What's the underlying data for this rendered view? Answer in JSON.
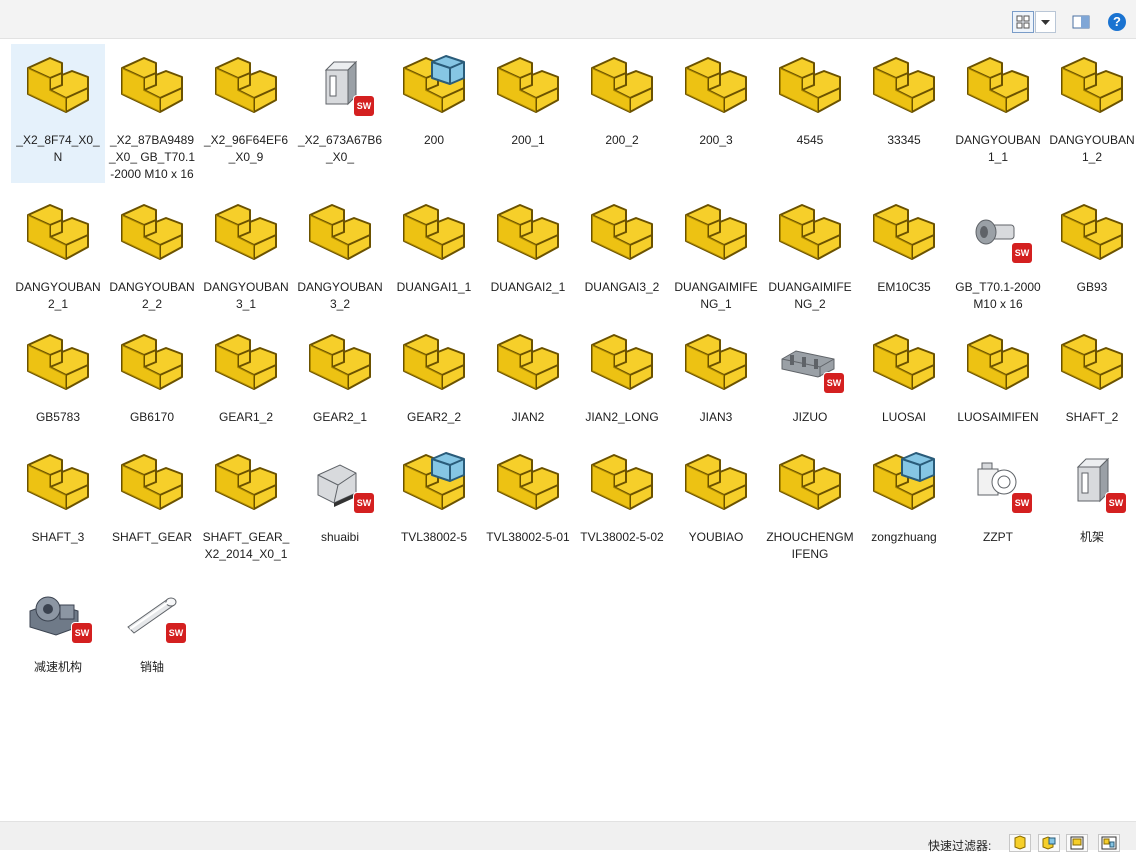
{
  "toolbar": {
    "view_icon": "thumbnail-view-icon",
    "dropdown_icon": "chevron-down-icon",
    "preview_icon": "preview-pane-icon",
    "help_label": "?"
  },
  "colors": {
    "folder_yellow": "#f6cf2a",
    "folder_edge": "#8a6b00",
    "assembly_blue": "#86c6e4",
    "sw_red": "#d42020",
    "selected_bg": "#e5f1fb"
  },
  "items": [
    {
      "label": "_X2_8F74_X0_N",
      "icon": "part-icon",
      "selected": true
    },
    {
      "label": "_X2_87BA9489_X0_ GB_T70.1-2000 M10 x 16",
      "icon": "part-icon"
    },
    {
      "label": "_X2_96F64EF6_X0_9",
      "icon": "part-icon"
    },
    {
      "label": "_X2_673A67B6_X0_",
      "icon": "profile-thumbnail-icon"
    },
    {
      "label": "200",
      "icon": "assembly-icon"
    },
    {
      "label": "200_1",
      "icon": "part-icon"
    },
    {
      "label": "200_2",
      "icon": "part-icon"
    },
    {
      "label": "200_3",
      "icon": "part-icon"
    },
    {
      "label": "4545",
      "icon": "part-icon"
    },
    {
      "label": "33345",
      "icon": "part-icon"
    },
    {
      "label": "DANGYOUBAN1_1",
      "icon": "part-icon"
    },
    {
      "label": "DANGYOUBAN1_2",
      "icon": "part-icon"
    },
    {
      "label": "DANGYOUBAN2_1",
      "icon": "part-icon"
    },
    {
      "label": "DANGYOUBAN2_2",
      "icon": "part-icon"
    },
    {
      "label": "DANGYOUBAN3_1",
      "icon": "part-icon"
    },
    {
      "label": "DANGYOUBAN3_2",
      "icon": "part-icon"
    },
    {
      "label": "DUANGAI1_1",
      "icon": "part-icon"
    },
    {
      "label": "DUANGAI2_1",
      "icon": "part-icon"
    },
    {
      "label": "DUANGAI3_2",
      "icon": "part-icon"
    },
    {
      "label": "DUANGAIMIFENG_1",
      "icon": "part-icon"
    },
    {
      "label": "DUANGAIMIFENG_2",
      "icon": "part-icon"
    },
    {
      "label": "EM10C35",
      "icon": "part-icon"
    },
    {
      "label": "GB_T70.1-2000 M10 x 16",
      "icon": "bolt-thumbnail-icon"
    },
    {
      "label": "GB93",
      "icon": "part-icon"
    },
    {
      "label": "GB5783",
      "icon": "part-icon"
    },
    {
      "label": "GB6170",
      "icon": "part-icon"
    },
    {
      "label": "GEAR1_2",
      "icon": "part-icon"
    },
    {
      "label": "GEAR2_1",
      "icon": "part-icon"
    },
    {
      "label": "GEAR2_2",
      "icon": "part-icon"
    },
    {
      "label": "JIAN2",
      "icon": "part-icon"
    },
    {
      "label": "JIAN2_LONG",
      "icon": "part-icon"
    },
    {
      "label": "JIAN3",
      "icon": "part-icon"
    },
    {
      "label": "JIZUO",
      "icon": "base-thumbnail-icon"
    },
    {
      "label": "LUOSAI",
      "icon": "part-icon"
    },
    {
      "label": "LUOSAIMIFEN",
      "icon": "part-icon"
    },
    {
      "label": "SHAFT_2",
      "icon": "part-icon"
    },
    {
      "label": "SHAFT_3",
      "icon": "part-icon"
    },
    {
      "label": "SHAFT_GEAR",
      "icon": "part-icon"
    },
    {
      "label": "SHAFT_GEAR_X2_2014_X0_1",
      "icon": "part-icon"
    },
    {
      "label": "shuaibi",
      "icon": "sheet-thumbnail-icon"
    },
    {
      "label": "TVL38002-5",
      "icon": "assembly-icon"
    },
    {
      "label": "TVL38002-5-01",
      "icon": "part-icon"
    },
    {
      "label": "TVL38002-5-02",
      "icon": "part-icon"
    },
    {
      "label": "YOUBIAO",
      "icon": "part-icon"
    },
    {
      "label": "ZHOUCHENGMIFENG",
      "icon": "part-icon"
    },
    {
      "label": "zongzhuang",
      "icon": "assembly-icon"
    },
    {
      "label": "ZZPT",
      "icon": "fixture-thumbnail-icon"
    },
    {
      "label": "机架",
      "icon": "profile-thumbnail-icon"
    },
    {
      "label": "减速机构",
      "icon": "gearbox-thumbnail-icon"
    },
    {
      "label": "销轴",
      "icon": "pin-thumbnail-icon"
    }
  ],
  "sw_badge": "SW",
  "filter": {
    "label": "快速过滤器:",
    "buttons": [
      "filter-parts-icon",
      "filter-assemblies-icon",
      "filter-drawings-icon",
      "filter-top-level-icon"
    ]
  }
}
